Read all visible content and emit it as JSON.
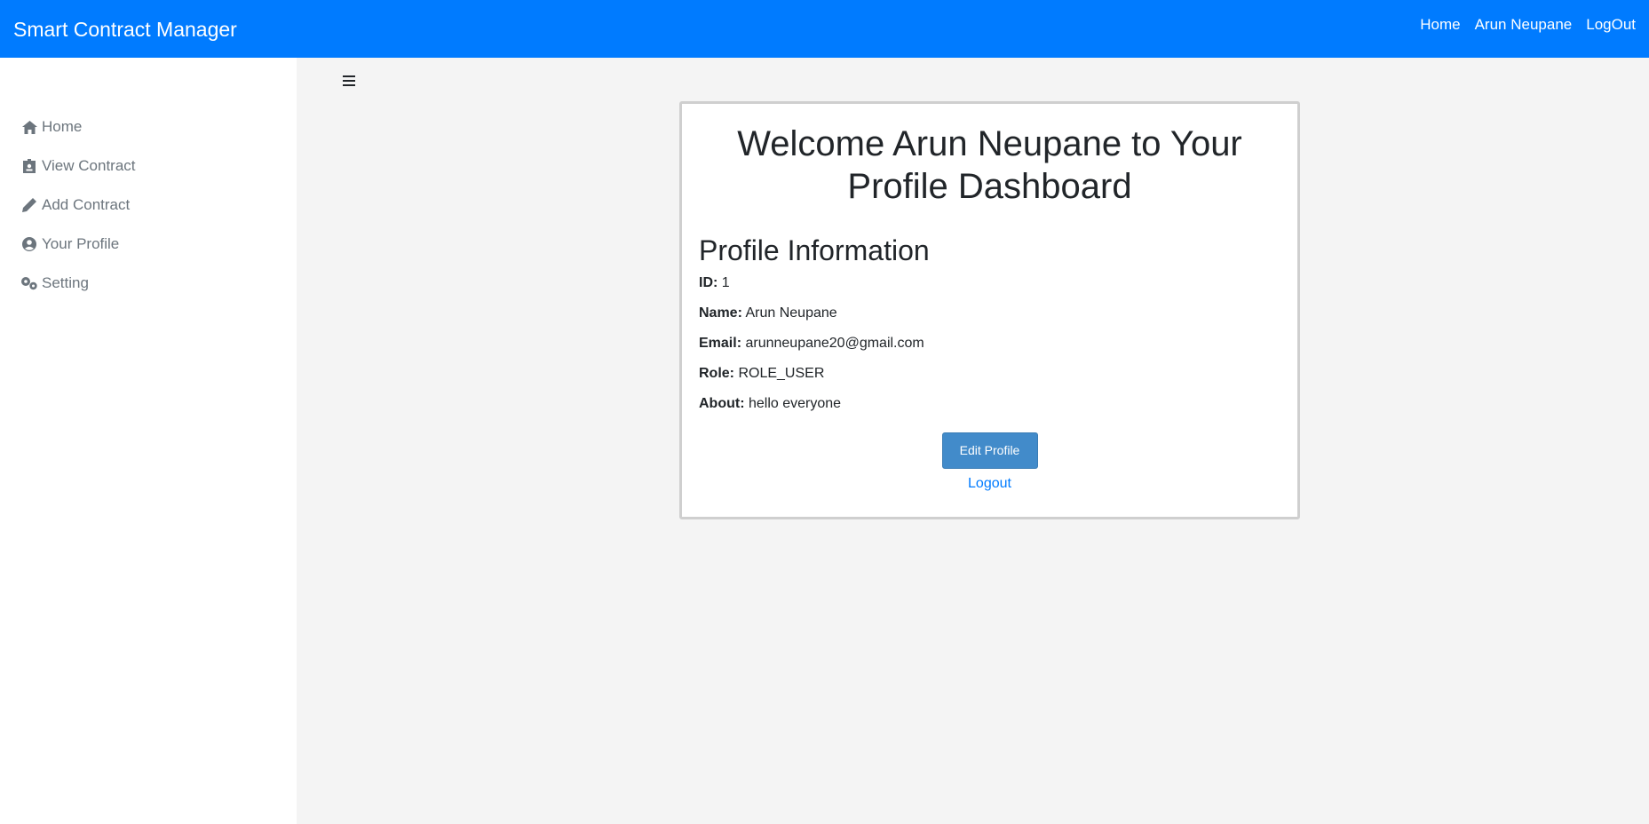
{
  "navbar": {
    "brand": "Smart Contract Manager",
    "links": [
      "Home",
      "Arun Neupane",
      "LogOut"
    ]
  },
  "sidebar": {
    "items": [
      {
        "label": "Home",
        "icon": "home-icon"
      },
      {
        "label": "View Contract",
        "icon": "id-card-icon"
      },
      {
        "label": "Add Contract",
        "icon": "pencil-icon"
      },
      {
        "label": "Your Profile",
        "icon": "user-circle-icon"
      },
      {
        "label": "Setting",
        "icon": "gears-icon"
      }
    ]
  },
  "main": {
    "menu_icon": "hamburger-icon",
    "title": "Welcome Arun Neupane to Your Profile Dashboard",
    "section_title": "Profile Information",
    "fields": [
      {
        "label": "ID:",
        "value": "1"
      },
      {
        "label": "Name:",
        "value": "Arun Neupane"
      },
      {
        "label": "Email:",
        "value": "arunneupane20@gmail.com"
      },
      {
        "label": "Role:",
        "value": "ROLE_USER"
      },
      {
        "label": "About:",
        "value": "hello everyone"
      }
    ],
    "edit_button": "Edit Profile",
    "logout_link": "Logout"
  },
  "colors": {
    "navbar": "#007bff",
    "button": "#428bca",
    "link": "#007bff",
    "background": "#f4f4f4"
  }
}
